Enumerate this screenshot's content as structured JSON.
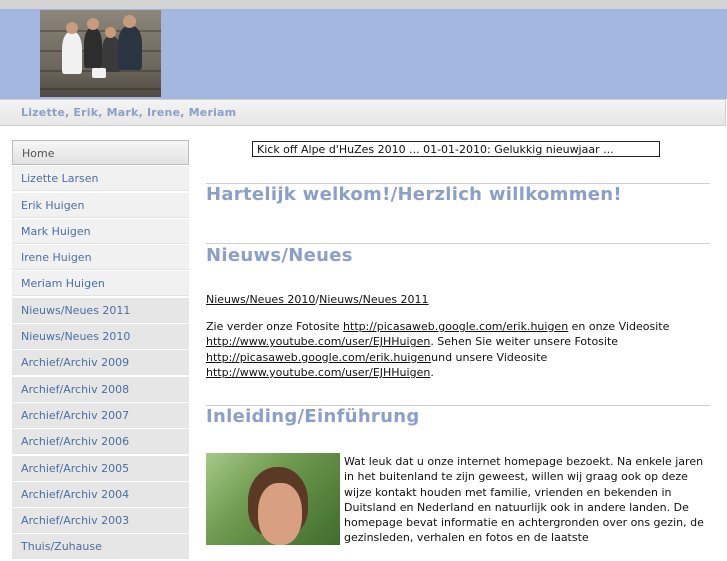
{
  "header": {
    "site_title": "Lizette, Erik, Mark, Irene, Meriam",
    "photo_label": "family-photo"
  },
  "nav": {
    "items": [
      {
        "label": "Home"
      },
      {
        "label": "Lizette Larsen"
      },
      {
        "label": "Erik Huigen"
      },
      {
        "label": "Mark Huigen"
      },
      {
        "label": "Irene Huigen"
      },
      {
        "label": "Meriam Huigen"
      },
      {
        "label": "Nieuws/Neues 2011"
      },
      {
        "label": "Nieuws/Neues 2010"
      },
      {
        "label": "Archief/Archiv 2009"
      },
      {
        "label": "Archief/Archiv 2008"
      },
      {
        "label": "Archief/Archiv 2007"
      },
      {
        "label": "Archief/Archiv 2006"
      },
      {
        "label": "Archief/Archiv 2005"
      },
      {
        "label": "Archief/Archiv 2004"
      },
      {
        "label": "Archief/Archiv 2003"
      },
      {
        "label": "Thuis/Zuhause"
      }
    ]
  },
  "ticker": {
    "text": "Kick off Alpe d'HuZes 2010 ... 01-01-2010: Gelukkig nieuwjaar ..."
  },
  "main": {
    "welcome_heading": "Hartelijk welkom!/Herzlich willkommen!",
    "news_heading": "Nieuws/Neues",
    "news_link_2010": "Nieuws/Neues 2010",
    "news_link_2011": "Nieuws/Neues 2011",
    "p_nl_1": "Zie verder onze Fotosite ",
    "picasa_url": "http://picasaweb.google.com/erik.huigen",
    "p_nl_2": " en onze Videosite ",
    "youtube_url": "http://www.youtube.com/user/EJHHuigen",
    "p_de_1": ". Sehen Sie weiter unsere Fotosite ",
    "p_de_2": "und unsere Videosite ",
    "p_end": ".",
    "intro_heading": "Inleiding/Einführung",
    "intro_text": "Wat leuk dat u onze internet homepage bezoekt. Na enkele jaren in het buitenland te zijn geweest, willen wij graag ook op deze wijze kontakt houden met familie, vrienden en bekenden in Duitsland en Nederland en natuurlijk ook in andere landen. De homepage bevat informatie en achtergronden over ons gezin, de gezinsleden, verhalen en fotos en de laatste"
  }
}
